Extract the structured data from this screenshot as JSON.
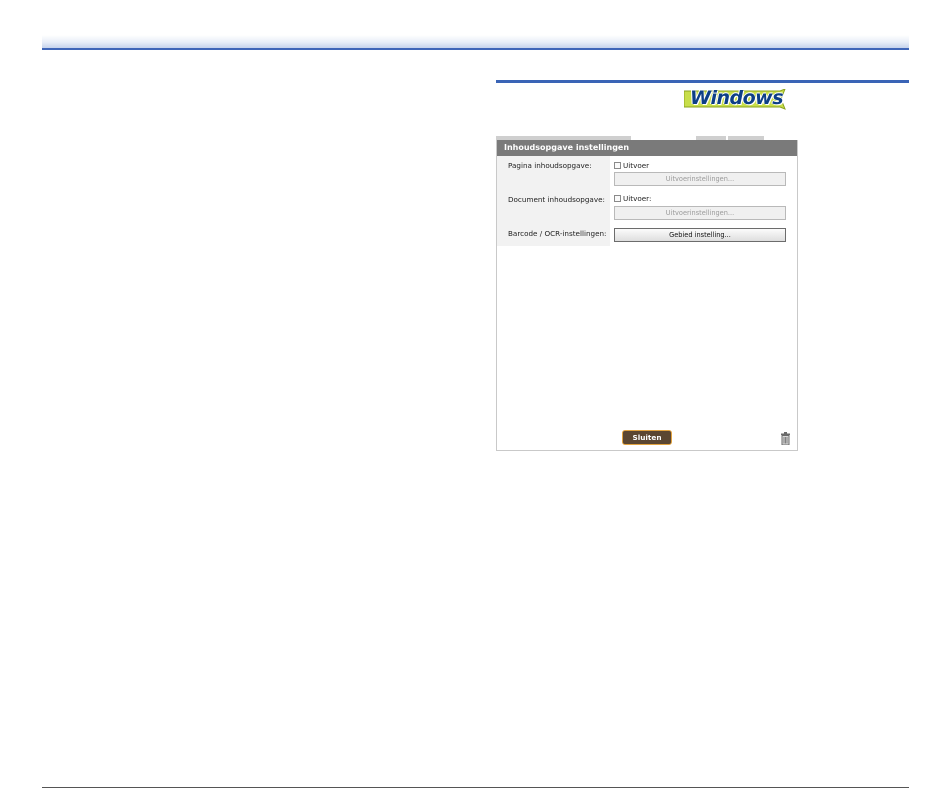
{
  "badge": {
    "text": "Windows"
  },
  "dialog": {
    "title": "Inhoudsopgave instellingen",
    "rows": [
      {
        "label": "Pagina inhoudsopgave:",
        "checkbox_label": "Uitvoer",
        "checked": false,
        "button_label": "Uitvoerinstellingen...",
        "button_enabled": false
      },
      {
        "label": "Document inhoudsopgave:",
        "checkbox_label": "Uitvoer:",
        "checked": false,
        "button_label": "Uitvoerinstellingen...",
        "button_enabled": false
      },
      {
        "label": "Barcode / OCR-instellingen:",
        "button_label": "Gebied instelling...",
        "button_enabled": true
      }
    ],
    "close_label": "Sluiten",
    "trash_icon": "trash-icon"
  },
  "colors": {
    "header_rule": "#3f66b8",
    "dialog_title_bg": "#7a7a7a",
    "close_button_bg": "#5b4631",
    "close_button_border": "#e2a340",
    "badge_bg": "#c8de4a"
  }
}
